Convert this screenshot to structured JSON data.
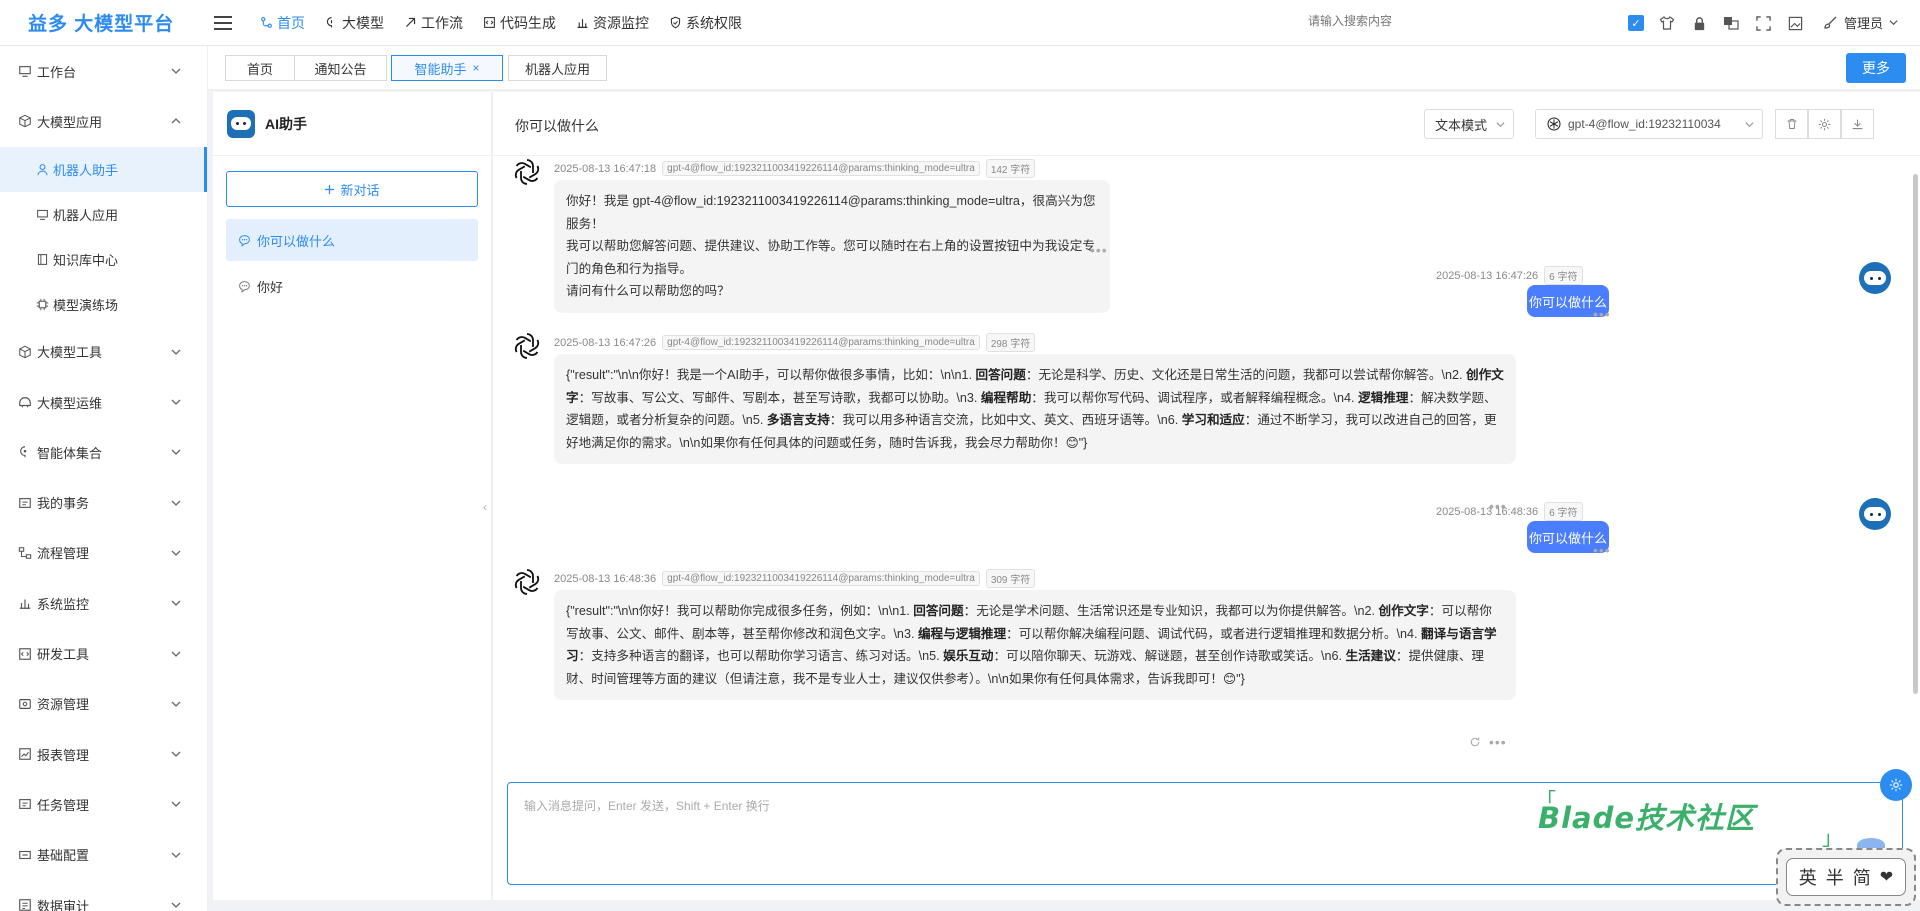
{
  "brand": "益多 大模型平台",
  "topnav": [
    {
      "label": "首页",
      "icon": "route-icon",
      "active": true
    },
    {
      "label": "大模型",
      "icon": "brain-icon",
      "active": false
    },
    {
      "label": "工作流",
      "icon": "workflow-icon",
      "active": false
    },
    {
      "label": "代码生成",
      "icon": "code-icon",
      "active": false
    },
    {
      "label": "资源监控",
      "icon": "monitor-icon",
      "active": false
    },
    {
      "label": "系统权限",
      "icon": "shield-icon",
      "active": false
    }
  ],
  "search": {
    "placeholder": "请输入搜索内容"
  },
  "user": {
    "name": "管理员"
  },
  "sidebar": {
    "items": [
      {
        "label": "工作台",
        "icon": "desktop-icon",
        "expanded": false
      },
      {
        "label": "大模型应用",
        "icon": "cube-icon",
        "expanded": true,
        "children": [
          {
            "label": "机器人助手",
            "icon": "user-icon",
            "active": true
          },
          {
            "label": "机器人应用",
            "icon": "desktop-icon",
            "active": false
          },
          {
            "label": "知识库中心",
            "icon": "book-icon",
            "active": false
          },
          {
            "label": "模型演练场",
            "icon": "chip-icon",
            "active": false
          }
        ]
      },
      {
        "label": "大模型工具",
        "icon": "cube-icon",
        "expanded": false
      },
      {
        "label": "大模型运维",
        "icon": "ops-icon",
        "expanded": false
      },
      {
        "label": "智能体集合",
        "icon": "agent-icon",
        "expanded": false
      },
      {
        "label": "我的事务",
        "icon": "task-icon",
        "expanded": false
      },
      {
        "label": "流程管理",
        "icon": "flow-icon",
        "expanded": false
      },
      {
        "label": "系统监控",
        "icon": "monitor-icon",
        "expanded": false
      },
      {
        "label": "研发工具",
        "icon": "code-icon",
        "expanded": false
      },
      {
        "label": "资源管理",
        "icon": "resource-icon",
        "expanded": false
      },
      {
        "label": "报表管理",
        "icon": "chart-icon",
        "expanded": false
      },
      {
        "label": "任务管理",
        "icon": "task-icon",
        "expanded": false
      },
      {
        "label": "基础配置",
        "icon": "config-icon",
        "expanded": false
      },
      {
        "label": "数据审计",
        "icon": "audit-icon",
        "expanded": false
      }
    ]
  },
  "tabs": [
    {
      "label": "首页",
      "active": false
    },
    {
      "label": "通知公告",
      "active": false
    },
    {
      "label": "智能助手",
      "active": true,
      "closable": "×"
    },
    {
      "label": "机器人应用",
      "active": false
    }
  ],
  "more_label": "更多",
  "assistant": {
    "title": "AI助手",
    "new_conversation": "新对话",
    "conversations": [
      {
        "label": "你可以做什么",
        "active": true
      },
      {
        "label": "你好",
        "active": false
      }
    ]
  },
  "chat": {
    "title": "你可以做什么",
    "mode": "文本模式",
    "model": "gpt-4@flow_id:19232110034",
    "input_placeholder": "输入消息提问，Enter 发送，Shift + Enter 换行",
    "messages": [
      {
        "role": "bot",
        "time": "2025-08-13 16:47:18",
        "model_tag": "gpt-4@flow_id:1923211003419226114@params:thinking_mode=ultra",
        "chars": "142 字符",
        "lines": [
          "你好！我是 gpt-4@flow_id:1923211003419226114@params:thinking_mode=ultra，很高兴为您服务！",
          "我可以帮助您解答问题、提供建议、协助工作等。您可以随时在右上角的设置按钮中为我设定专门的角色和行为指导。",
          "请问有什么可以帮助您的吗？"
        ]
      },
      {
        "role": "user",
        "time": "2025-08-13 16:47:26",
        "chars": "6 字符",
        "text": "你可以做什么"
      },
      {
        "role": "bot",
        "time": "2025-08-13 16:47:26",
        "model_tag": "gpt-4@flow_id:1923211003419226114@params:thinking_mode=ultra",
        "chars": "298 字符",
        "parts": [
          {
            "t": "{\"result\":\"\\n\\n你好！我是一个AI助手，可以帮你做很多事情，比如：\\n\\n1. "
          },
          {
            "b": "回答问题"
          },
          {
            "t": "：无论是科学、历史、文化还是日常生活的问题，我都可以尝试帮你解答。\\n2. "
          },
          {
            "b": "创作文字"
          },
          {
            "t": "：写故事、写公文、写邮件、写剧本，甚至写诗歌，我都可以协助。\\n3. "
          },
          {
            "b": "编程帮助"
          },
          {
            "t": "：我可以帮你写代码、调试程序，或者解释编程概念。\\n4. "
          },
          {
            "b": "逻辑推理"
          },
          {
            "t": "：解决数学题、逻辑题，或者分析复杂的问题。\\n5. "
          },
          {
            "b": "多语言支持"
          },
          {
            "t": "：我可以用多种语言交流，比如中文、英文、西班牙语等。\\n6. "
          },
          {
            "b": "学习和适应"
          },
          {
            "t": "：通过不断学习，我可以改进自己的回答，更好地满足你的需求。\\n\\n如果你有任何具体的问题或任务，随时告诉我，我会尽力帮助你！😊\"}"
          }
        ]
      },
      {
        "role": "user",
        "time": "2025-08-13 16:48:36",
        "chars": "6 字符",
        "text": "你可以做什么"
      },
      {
        "role": "bot",
        "time": "2025-08-13 16:48:36",
        "model_tag": "gpt-4@flow_id:1923211003419226114@params:thinking_mode=ultra",
        "chars": "309 字符",
        "parts": [
          {
            "t": "{\"result\":\"\\n\\n你好！我可以帮助你完成很多任务，例如：\\n\\n1. "
          },
          {
            "b": "回答问题"
          },
          {
            "t": "：无论是学术问题、生活常识还是专业知识，我都可以为你提供解答。\\n2. "
          },
          {
            "b": "创作文字"
          },
          {
            "t": "：可以帮你写故事、公文、邮件、剧本等，甚至帮你修改和润色文字。\\n3. "
          },
          {
            "b": "编程与逻辑推理"
          },
          {
            "t": "：可以帮你解决编程问题、调试代码，或者进行逻辑推理和数据分析。\\n4. "
          },
          {
            "b": "翻译与语言学习"
          },
          {
            "t": "：支持多种语言的翻译，也可以帮助你学习语言、练习对话。\\n5. "
          },
          {
            "b": "娱乐互动"
          },
          {
            "t": "：可以陪你聊天、玩游戏、解谜题，甚至创作诗歌或笑话。\\n6. "
          },
          {
            "b": "生活建议"
          },
          {
            "t": "：提供健康、理财、时间管理等方面的建议（但请注意，我不是专业人士，建议仅供参考）。\\n\\n如果你有任何具体需求，告诉我即可！😊\"}"
          }
        ]
      }
    ]
  },
  "watermark": "Blade技术社区",
  "ime": {
    "chars": [
      "英",
      "半",
      "简"
    ]
  },
  "colors": {
    "accent": "#2d8cf0",
    "user_bubble": "#4a7dff",
    "watermark": "#3ab06a"
  }
}
